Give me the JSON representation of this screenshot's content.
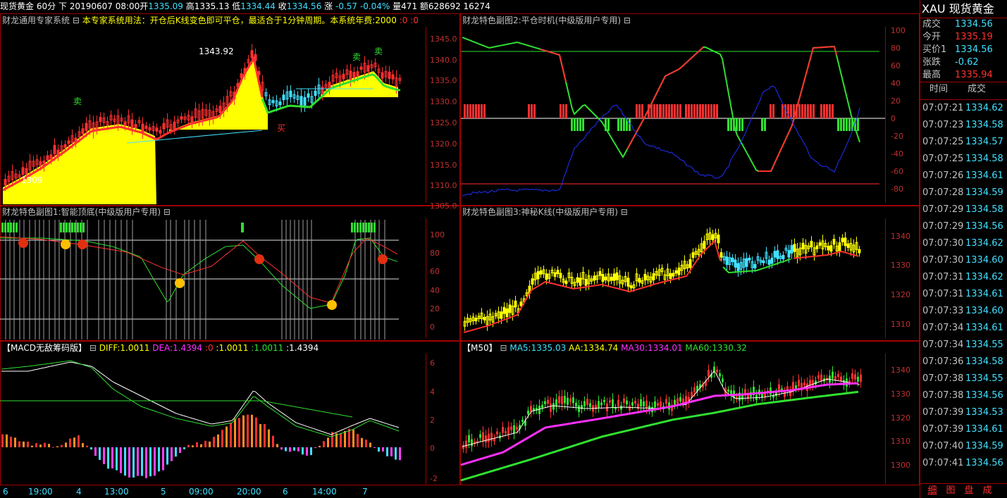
{
  "topbar": {
    "symbol": "现货黄金",
    "period": "60分",
    "direction": "下",
    "datetime": "20190607 08:00",
    "open_label": "开",
    "open_val": "1335.09",
    "high_label": "高",
    "high_val": "1335.13",
    "low_label": "低",
    "low_val": "1334.44",
    "close_label": "收",
    "close_val": "1334.56",
    "change_label": "涨",
    "change_val": "-0.57",
    "change_pct": "-0.04%",
    "volume": "量471",
    "amount": "额628692",
    "extra": "16274"
  },
  "colors": {
    "up": "#ff3030",
    "down": "#40e0ff",
    "yellow": "#ffff00",
    "green": "#30e030",
    "magenta": "#ff30ff",
    "border": "#a00000",
    "white": "#ffffff"
  },
  "panel_main": {
    "name": "财龙通用专家系统",
    "usage": "本专家系统用法：开仓后K线变色即可平仓，最适合于1分钟周期。本系统年费:2000",
    "v1": ":0",
    "v2": ":0",
    "ann_high": "1343.92",
    "ann_low": "1309",
    "sell1": "卖",
    "sell2": "卖",
    "sell3": "卖",
    "buy1": "买",
    "y_ticks": [
      "1345.0",
      "1340.0",
      "1335.0",
      "1330.0",
      "1325.0",
      "1320.0",
      "1315.0",
      "1310.0",
      "1305.0"
    ]
  },
  "panel_sub2": {
    "title": "财龙特色副图2:平仓时机(中级版用户专用)",
    "y_ticks": [
      "100",
      "80",
      "60",
      "40",
      "20",
      "0",
      "-20",
      "-40",
      "-60",
      "-80"
    ]
  },
  "panel_sub1": {
    "title": "财龙特色副图1:智能顶底(中级版用户专用)",
    "y_ticks": [
      "100",
      "80",
      "60",
      "40",
      "20",
      "0"
    ]
  },
  "panel_sub3": {
    "title": "财龙特色副图3:神秘K线(中级版用户专用)",
    "y_ticks": [
      "1340",
      "1330",
      "1320",
      "1310"
    ]
  },
  "panel_macd": {
    "name": "【MACD无敌筹码版】",
    "diff": "DIFF:1.0011",
    "dea": "DEA:1.4394",
    "v0": ":0",
    "v1": ":1.0011",
    "v2": ":1.0011",
    "v3": ":1.4394",
    "y_ticks": [
      "6",
      "4",
      "2",
      "0",
      "-2"
    ]
  },
  "panel_ma": {
    "name": "【M50】",
    "ma5": "MA5:1335.03",
    "aa": "AA:1334.74",
    "ma30": "MA30:1334.01",
    "ma60": "MA60:1330.32",
    "y_ticks": [
      "1340",
      "1330",
      "1320",
      "1310",
      "1300"
    ]
  },
  "x_axis": [
    "6",
    "19:00",
    "4",
    "13:00",
    "5",
    "09:00",
    "20:00",
    "6",
    "14:00",
    "7"
  ],
  "quote": {
    "code": "XAU",
    "name": "现货黄金",
    "rows": [
      {
        "k": "成交",
        "v": "1334.56",
        "c": "#40e0ff"
      },
      {
        "k": "今开",
        "v": "1335.19",
        "c": "#ff3030"
      },
      {
        "k": "买价1",
        "v": "1334.56",
        "c": "#40e0ff"
      },
      {
        "k": "张跌",
        "v": "-0.62",
        "c": "#40e0ff"
      },
      {
        "k": "最高",
        "v": "1335.94",
        "c": "#ff3030"
      }
    ],
    "ticks_header_time": "时间",
    "ticks_header_price": "成交",
    "ticks": [
      {
        "t": "07:07:21",
        "p": "1334.62"
      },
      {
        "t": "07:07:23",
        "p": "1334.58"
      },
      {
        "t": "07:07:25",
        "p": "1334.57"
      },
      {
        "t": "07:07:25",
        "p": "1334.58"
      },
      {
        "t": "07:07:26",
        "p": "1334.61"
      },
      {
        "t": "07:07:28",
        "p": "1334.59"
      },
      {
        "t": "07:07:29",
        "p": "1334.58"
      },
      {
        "t": "07:07:29",
        "p": "1334.56"
      },
      {
        "t": "07:07:30",
        "p": "1334.62"
      },
      {
        "t": "07:07:30",
        "p": "1334.60"
      },
      {
        "t": "07:07:31",
        "p": "1334.62"
      },
      {
        "t": "07:07:31",
        "p": "1334.61"
      },
      {
        "t": "07:07:33",
        "p": "1334.60"
      },
      {
        "t": "07:07:34",
        "p": "1334.61"
      },
      {
        "t": "07:07:34",
        "p": "1334.55"
      },
      {
        "t": "07:07:36",
        "p": "1334.58"
      },
      {
        "t": "07:07:38",
        "p": "1334.55"
      },
      {
        "t": "07:07:38",
        "p": "1334.56"
      },
      {
        "t": "07:07:39",
        "p": "1334.53"
      },
      {
        "t": "07:07:39",
        "p": "1334.61"
      },
      {
        "t": "07:07:40",
        "p": "1334.59"
      },
      {
        "t": "07:07:41",
        "p": "1334.56"
      }
    ],
    "tabs": [
      "细",
      "图",
      "盘",
      "成"
    ]
  }
}
